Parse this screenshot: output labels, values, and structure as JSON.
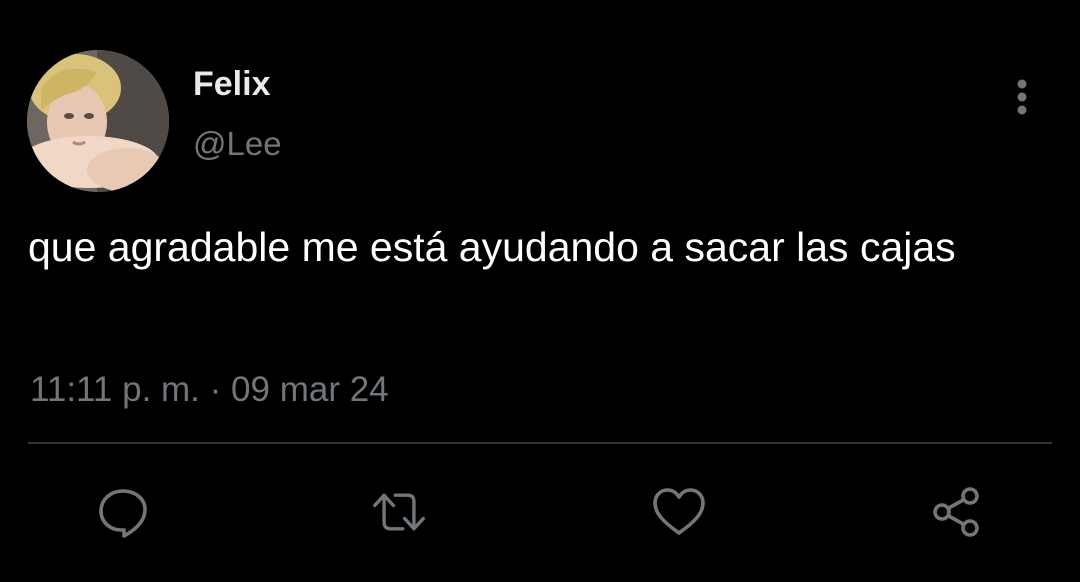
{
  "tweet": {
    "author": {
      "display_name": "Felix",
      "handle": "@Lee",
      "avatar": "avatar-photo"
    },
    "text": "que agradable me está ayudando a sacar las cajas",
    "time": "11:11 p. m.",
    "separator": "·",
    "date": "09 mar 24"
  },
  "actions": [
    {
      "icon": "reply-icon"
    },
    {
      "icon": "retweet-icon"
    },
    {
      "icon": "heart-icon"
    },
    {
      "icon": "share-icon"
    }
  ],
  "menu": {
    "icon": "more-vertical-icon"
  },
  "colors": {
    "background": "#000000",
    "primary_text": "#e7e9ea",
    "secondary_text": "#71767b",
    "divider": "#2f3336"
  }
}
